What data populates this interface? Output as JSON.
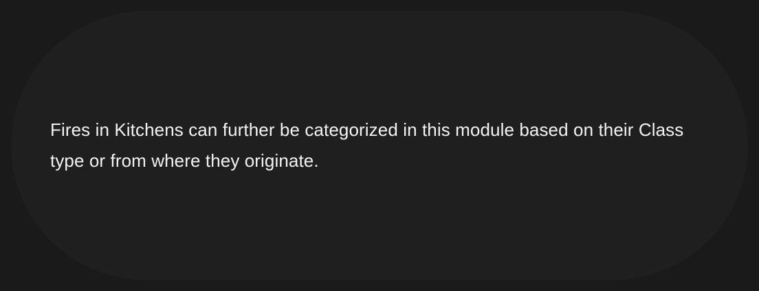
{
  "card": {
    "text": "Fires in Kitchens can further be categorized in this module based on their Class type or from where they originate."
  },
  "colors": {
    "page_background": "#1a1a1a",
    "card_background": "#1f1f1f",
    "text": "#f2f2f2"
  }
}
